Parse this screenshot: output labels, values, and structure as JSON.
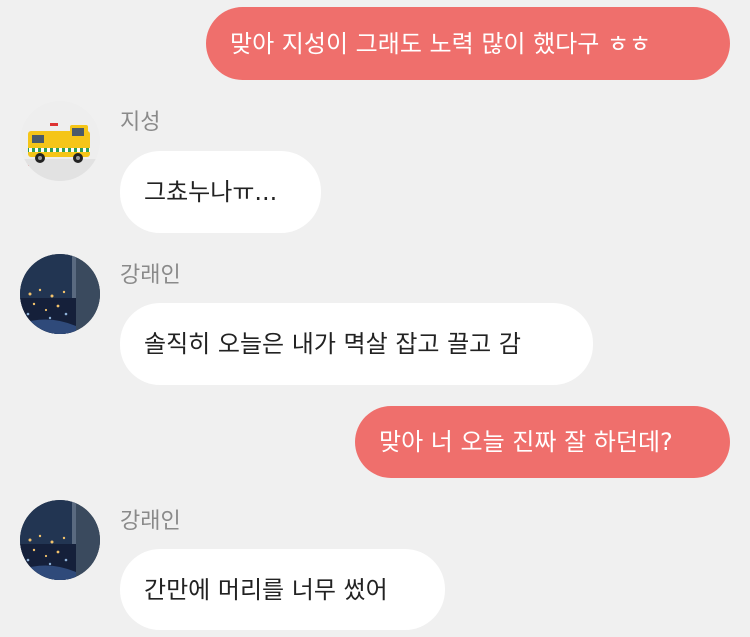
{
  "colors": {
    "my_bubble": "#ef6f6c",
    "other_bubble": "#ffffff",
    "background": "#f0f0f0",
    "sender_name": "#8a8a8a"
  },
  "messages": [
    {
      "from": "me",
      "text": "맞아 지성이 그래도 노력 많이 했다구 ㅎㅎ"
    },
    {
      "from": "other",
      "sender": "지성",
      "avatar": "ambulance-avatar",
      "text": "그쵸누나ㅠ..."
    },
    {
      "from": "other",
      "sender": "강래인",
      "avatar": "night-window-avatar",
      "text": "솔직히 오늘은 내가 멱살 잡고 끌고 감"
    },
    {
      "from": "me",
      "text": "맞아 너 오늘 진짜 잘 하던데?"
    },
    {
      "from": "other",
      "sender": "강래인",
      "avatar": "night-window-avatar",
      "text": "간만에 머리를 너무 썼어"
    }
  ]
}
